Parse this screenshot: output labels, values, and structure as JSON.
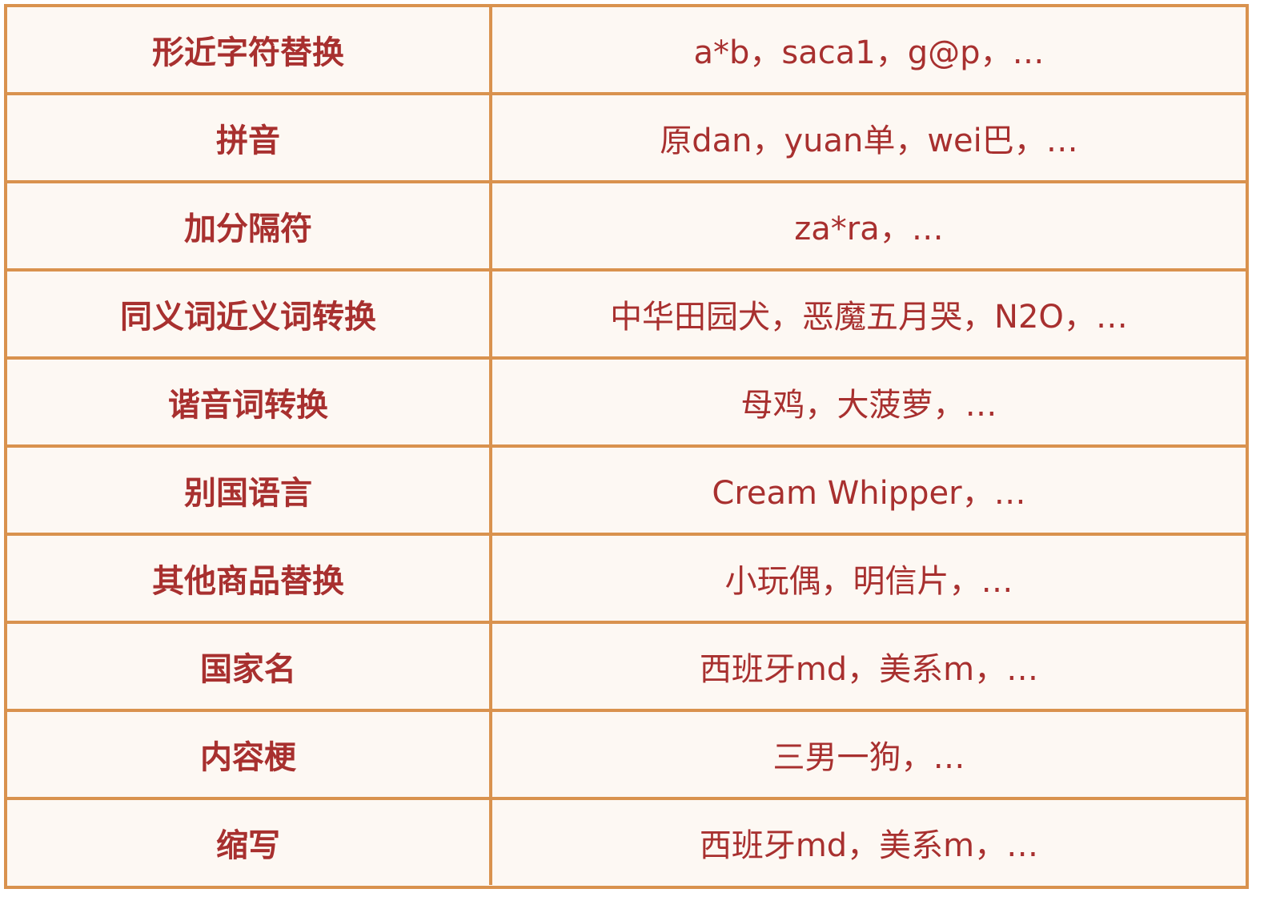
{
  "table": {
    "rows": [
      {
        "type": "形近字符替换",
        "example": "a*b，saca1，g@p，…"
      },
      {
        "type": "拼音",
        "example": "原dan，yuan单，wei巴，…"
      },
      {
        "type": "加分隔符",
        "example": "za*ra，…"
      },
      {
        "type": "同义词近义词转换",
        "example": "中华田园犬，恶魔五月哭，N2O，…"
      },
      {
        "type": "谐音词转换",
        "example": "母鸡，大菠萝，…"
      },
      {
        "type": "别国语言",
        "example": "Cream Whipper，…"
      },
      {
        "type": "其他商品替换",
        "example": "小玩偶，明信片，…"
      },
      {
        "type": "国家名",
        "example": "西班牙md，美系m，…"
      },
      {
        "type": "内容梗",
        "example": "三男一狗，…"
      },
      {
        "type": "缩写",
        "example": "西班牙md，美系m，…"
      }
    ]
  },
  "colors": {
    "border": "#d9924e",
    "background": "#fdf8f3",
    "text": "#a8302f"
  }
}
